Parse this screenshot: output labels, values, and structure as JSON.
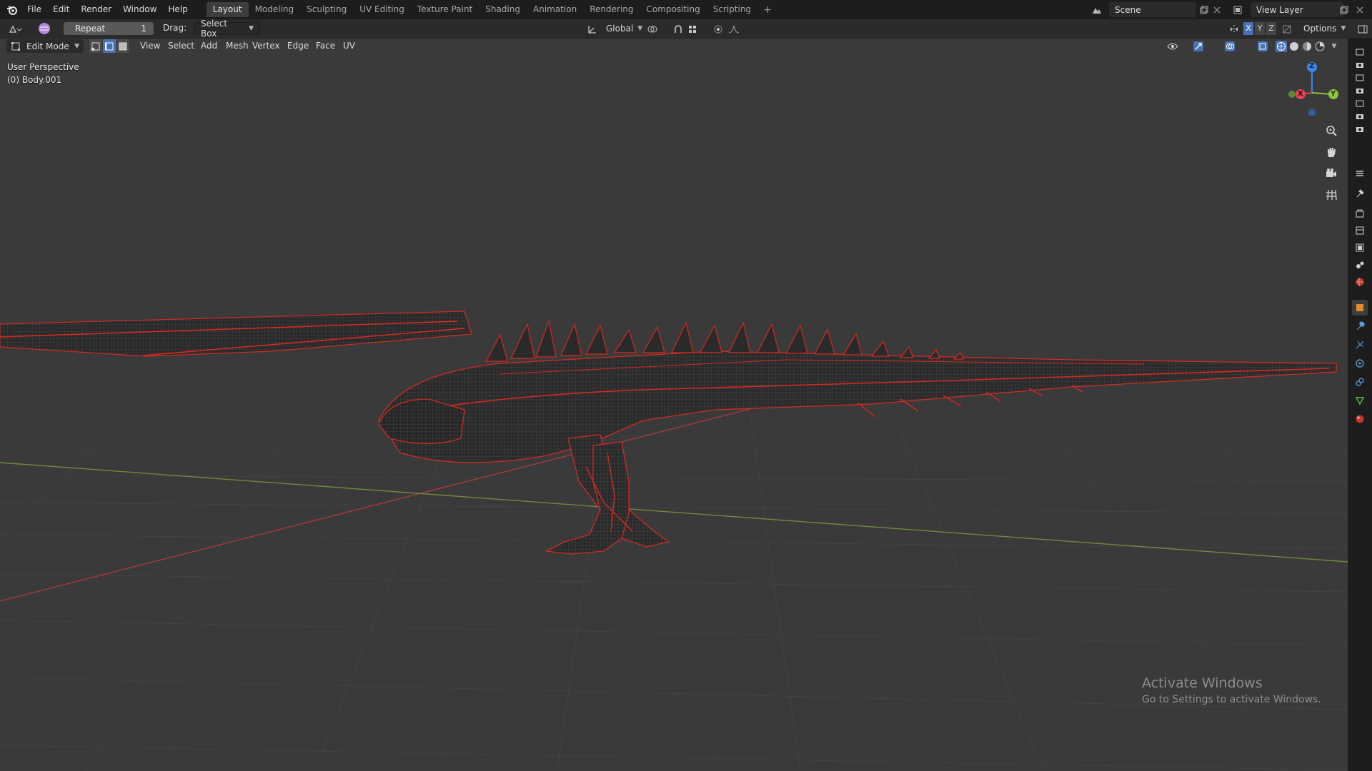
{
  "top_menu": [
    "File",
    "Edit",
    "Render",
    "Window",
    "Help"
  ],
  "workspace_tabs": [
    {
      "label": "Layout",
      "active": true
    },
    {
      "label": "Modeling",
      "active": false
    },
    {
      "label": "Sculpting",
      "active": false
    },
    {
      "label": "UV Editing",
      "active": false
    },
    {
      "label": "Texture Paint",
      "active": false
    },
    {
      "label": "Shading",
      "active": false
    },
    {
      "label": "Animation",
      "active": false
    },
    {
      "label": "Rendering",
      "active": false
    },
    {
      "label": "Compositing",
      "active": false
    },
    {
      "label": "Scripting",
      "active": false
    }
  ],
  "workspace_add": "+",
  "scene": {
    "name": "Scene"
  },
  "view_layer": {
    "name": "View Layer"
  },
  "tool_settings": {
    "repeat_label": "Repeat",
    "repeat_value": "1",
    "drag_label": "Drag:",
    "drag_value": "Select Box",
    "transform_orientation": "Global",
    "axis_labels": [
      "X",
      "Y",
      "Z"
    ],
    "options_label": "Options"
  },
  "viewport_header": {
    "mode": "Edit Mode",
    "menus": [
      "View",
      "Select",
      "Add",
      "Mesh",
      "Vertex",
      "Edge",
      "Face",
      "UV"
    ]
  },
  "viewport": {
    "perspective_label": "User Perspective",
    "object_label": "(0) Body.001",
    "gizmo_axes": {
      "x": "X",
      "y": "Y",
      "z": "Z"
    }
  },
  "watermark": {
    "title": "Activate Windows",
    "subtitle": "Go to Settings to activate Windows."
  },
  "colors": {
    "wire_red": "#d42a20",
    "mesh_dark": "#1e1e1e",
    "axis_x": "#a83a3a",
    "axis_y": "#6f8a3a",
    "gizmo_x": "#e04454",
    "gizmo_y": "#8bc63a",
    "gizmo_z": "#3b86ea"
  }
}
